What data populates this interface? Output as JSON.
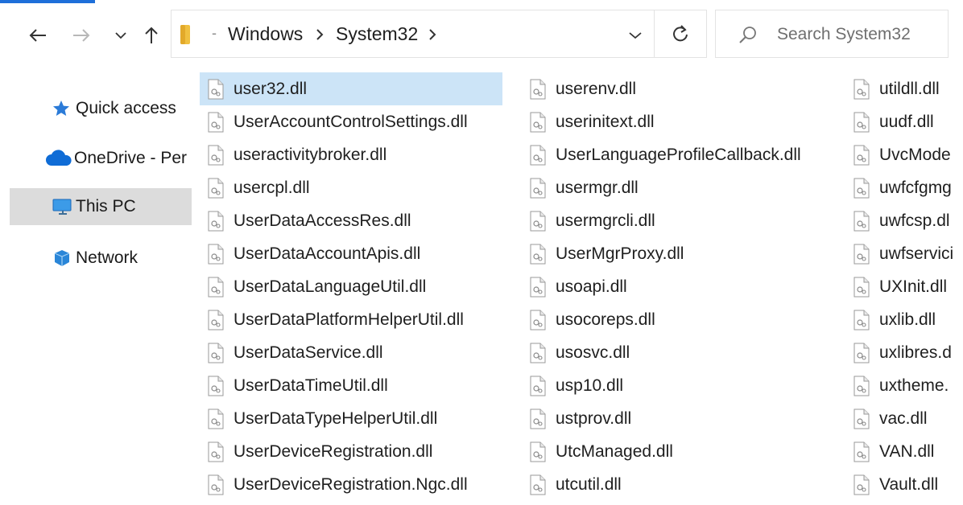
{
  "window": {
    "accent_color": "#1e6fd9",
    "selection_color": "#cce4f7",
    "nav_selected_color": "#dcdcdc"
  },
  "toolbar": {
    "back_icon": "arrow-left-icon",
    "forward_icon": "arrow-right-icon",
    "recent_icon": "chevron-down-icon",
    "up_icon": "arrow-up-icon",
    "refresh_icon": "refresh-icon"
  },
  "address": {
    "separator_lead": "-",
    "crumbs": [
      "Windows",
      "System32"
    ]
  },
  "search": {
    "placeholder": "Search System32"
  },
  "nav": {
    "items": [
      {
        "label": "Quick access",
        "icon": "star-icon"
      },
      {
        "label": "OneDrive - Per",
        "icon": "cloud-icon"
      },
      {
        "label": "This PC",
        "icon": "computer-icon"
      },
      {
        "label": "Network",
        "icon": "network-icon"
      }
    ],
    "selected_index": 2
  },
  "files": {
    "columns": [
      [
        "user32.dll",
        "UserAccountControlSettings.dll",
        "useractivitybroker.dll",
        "usercpl.dll",
        "UserDataAccessRes.dll",
        "UserDataAccountApis.dll",
        "UserDataLanguageUtil.dll",
        "UserDataPlatformHelperUtil.dll",
        "UserDataService.dll",
        "UserDataTimeUtil.dll",
        "UserDataTypeHelperUtil.dll",
        "UserDeviceRegistration.dll",
        "UserDeviceRegistration.Ngc.dll"
      ],
      [
        "userenv.dll",
        "userinitext.dll",
        "UserLanguageProfileCallback.dll",
        "usermgr.dll",
        "usermgrcli.dll",
        "UserMgrProxy.dll",
        "usoapi.dll",
        "usocoreps.dll",
        "usosvc.dll",
        "usp10.dll",
        "ustprov.dll",
        "UtcManaged.dll",
        "utcutil.dll"
      ],
      [
        "utildll.dll",
        "uudf.dll",
        "UvcMode",
        "uwfcfgmg",
        "uwfcsp.dl",
        "uwfservici",
        "UXInit.dll",
        "uxlib.dll",
        "uxlibres.d",
        "uxtheme.",
        "vac.dll",
        "VAN.dll",
        "Vault.dll"
      ]
    ],
    "selected": "user32.dll",
    "item_icon": "dll-file-icon"
  }
}
